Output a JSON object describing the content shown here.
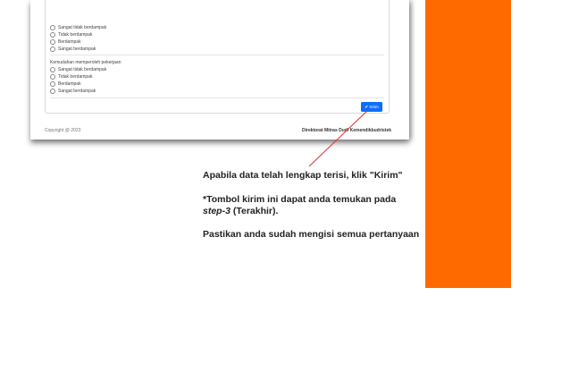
{
  "form": {
    "question1_options": [
      "Sangat tidak berdampak",
      "Tidak berdampak",
      "Berdampak",
      "Sangat berdampak"
    ],
    "question2_title": "Kemudahan memperoleh pekerjaan",
    "question2_options": [
      "Sangat tidak berdampak",
      "Tidak berdampak",
      "Berdampak",
      "Sangat berdampak"
    ],
    "submit_label": "Kirim",
    "footer_copyright": "Copyright @ 2023",
    "footer_org": "Direktorat Mitras Dudi Kemendikbudristek"
  },
  "instructions": {
    "line1": "Apabila data telah lengkap terisi, klik \"Kirim\"",
    "line2": "*Tombol kirim ini dapat anda temukan pada",
    "line3_step": "step-3",
    "line3_rest": " (Terakhir).",
    "line4": "Pastikan anda sudah mengisi semua pertanyaan"
  },
  "colors": {
    "accent_orange": "#ff6a00",
    "button_blue": "#0d6efd",
    "arrow_red": "#e0302a"
  },
  "icons": {
    "submit_icon": "check-icon"
  }
}
